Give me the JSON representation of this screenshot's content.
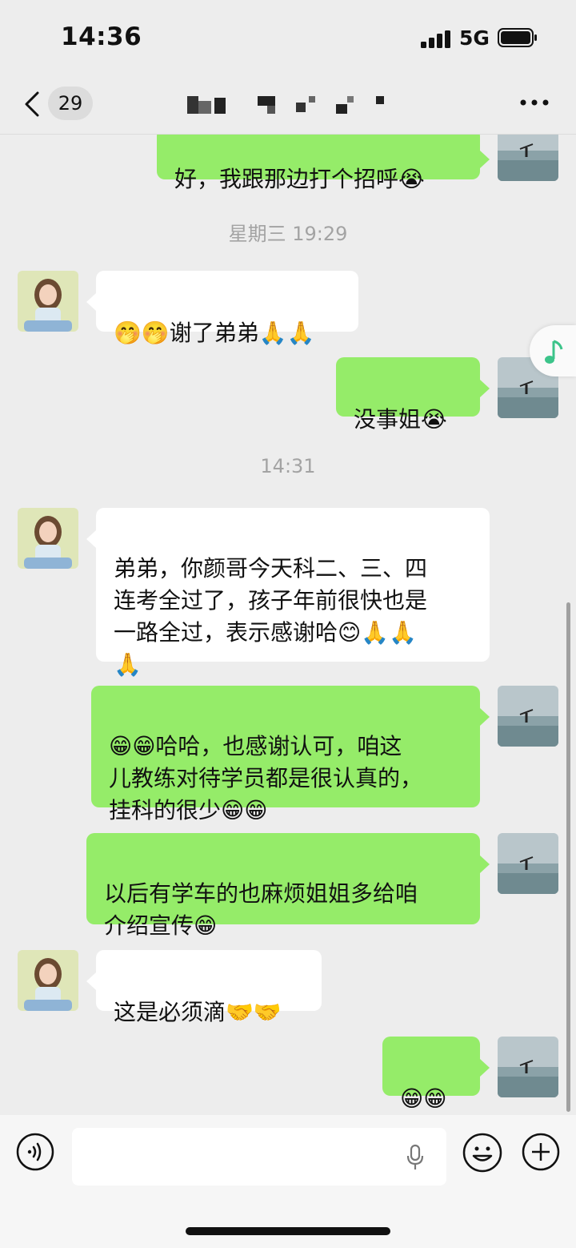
{
  "status_bar": {
    "time": "14:36",
    "network": "5G"
  },
  "header": {
    "unread_count": "29"
  },
  "theme": {
    "own_bubble": "#95ec69",
    "peer_bubble": "#ffffff",
    "background": "#ededed"
  },
  "messages": [
    {
      "from": "me",
      "text": "好，我跟那边打个招呼😭"
    },
    {
      "type": "timestamp",
      "text": "星期三 19:29"
    },
    {
      "from": "peer",
      "text": "🤭🤭谢了弟弟🙏🙏"
    },
    {
      "from": "me",
      "text": "没事姐😭"
    },
    {
      "type": "timestamp",
      "text": "14:31"
    },
    {
      "from": "peer",
      "text": "弟弟，你颜哥今天科二、三、四\n连考全过了，孩子年前很快也是\n一路全过，表示感谢哈😊🙏🙏\n🙏"
    },
    {
      "from": "me",
      "text": "😁😁哈哈，也感谢认可，咱这\n儿教练对待学员都是很认真的，\n挂科的很少😁😁"
    },
    {
      "from": "me",
      "text": "以后有学车的也麻烦姐姐多给咱\n介绍宣传😁"
    },
    {
      "from": "peer",
      "text": "这是必须滴🤝🤝"
    },
    {
      "from": "me",
      "text": "😁😁"
    }
  ],
  "icons": {
    "back": "chevron-left-icon",
    "more": "more-dots-icon",
    "music": "music-note-icon",
    "voice": "voice-input-icon",
    "mic": "microphone-icon",
    "emoji": "emoji-icon",
    "plus": "plus-icon"
  }
}
